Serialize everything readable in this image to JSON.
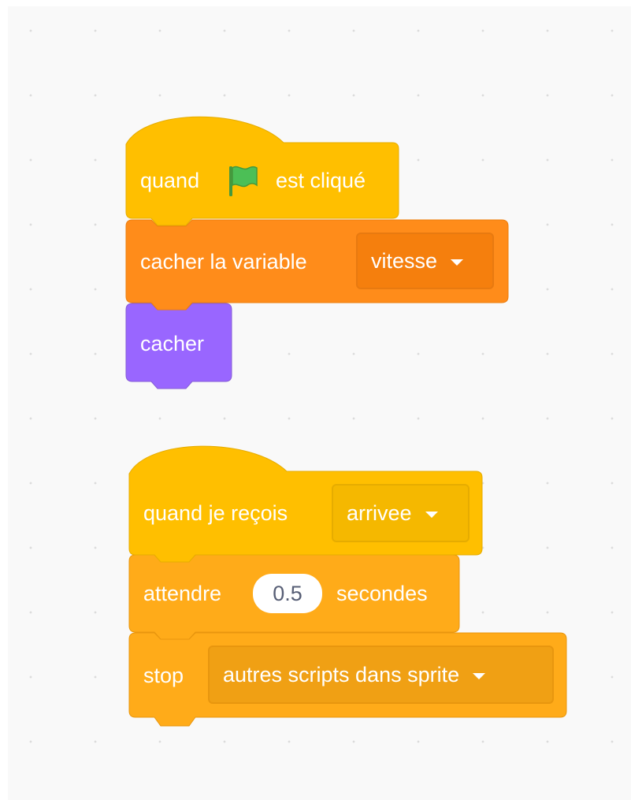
{
  "script_1": {
    "hat_block": {
      "text_before": "quand",
      "icon": "green-flag-icon",
      "text_after": "est cliqué"
    },
    "hide_variable_block": {
      "label": "cacher la variable",
      "variable_dropdown": "vitesse"
    },
    "hide_block": {
      "label": "cacher"
    }
  },
  "script_2": {
    "hat_block": {
      "label": "quand je reçois",
      "message_dropdown": "arrivee"
    },
    "wait_block": {
      "label_before": "attendre",
      "duration_value": "0.5",
      "label_after": "secondes"
    },
    "stop_block": {
      "label": "stop",
      "option_dropdown": "autres scripts dans sprite"
    }
  },
  "colors": {
    "events": "#ffbf00",
    "events_border": "#e6ac00",
    "variables": "#ff8c1a",
    "variables_border": "#ec7f10",
    "looks": "#9966ff",
    "control": "#ffab19",
    "control_border": "#e8960e",
    "flag": "#4cbf56"
  }
}
